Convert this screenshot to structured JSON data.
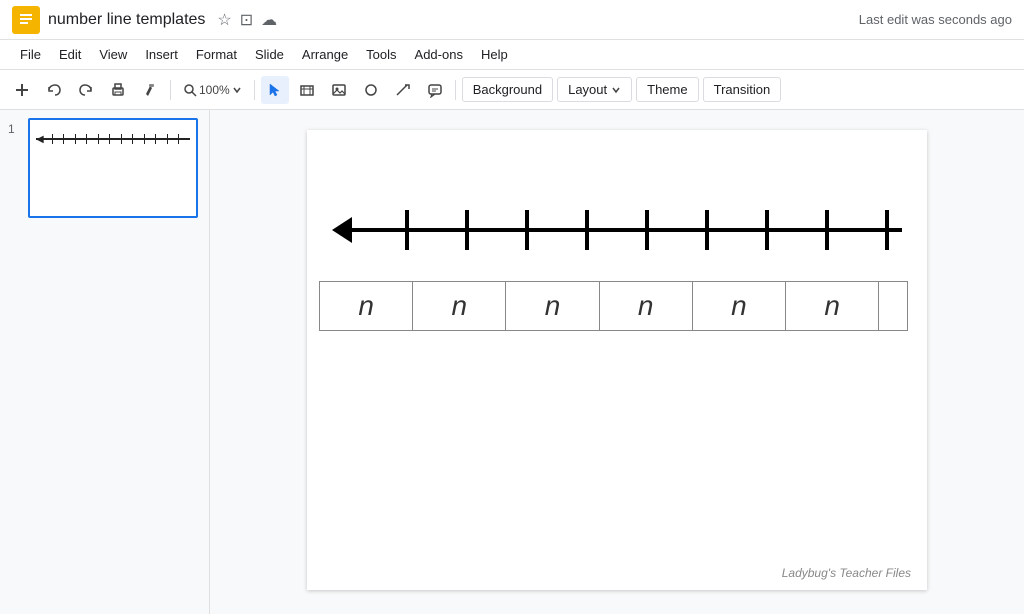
{
  "titleBar": {
    "appName": "Slides",
    "appLogoText": "S",
    "title": "number line templates",
    "lastEdit": "Last edit was seconds ago",
    "icons": {
      "star": "☆",
      "folder": "⊡",
      "cloud": "☁"
    }
  },
  "menuBar": {
    "items": [
      "File",
      "Edit",
      "View",
      "Insert",
      "Format",
      "Slide",
      "Arrange",
      "Tools",
      "Add-ons",
      "Help"
    ]
  },
  "toolbar": {
    "addLabel": "+",
    "undoLabel": "↩",
    "redoLabel": "↪",
    "printLabel": "🖨",
    "paintLabel": "🖌",
    "zoomLabel": "100%",
    "backgroundLabel": "Background",
    "layoutLabel": "Layout",
    "themeLabel": "Theme",
    "transitionLabel": "Transition"
  },
  "slide": {
    "number": "1",
    "numberLine": {
      "ticks": 9,
      "labels": [
        "n",
        "n",
        "n",
        "n",
        "n",
        "n"
      ]
    },
    "watermark": "Ladybug's Teacher Files"
  }
}
